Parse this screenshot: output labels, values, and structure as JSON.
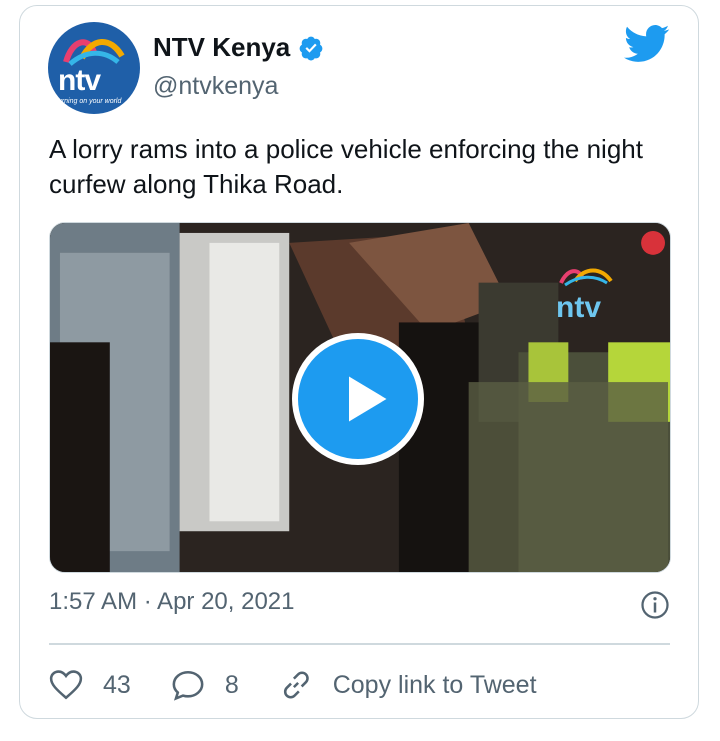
{
  "author": {
    "display_name": "NTV Kenya",
    "handle": "@ntvkenya",
    "avatar_logo_text": "ntv",
    "avatar_tagline": "turning on your world",
    "verified": true
  },
  "tweet": {
    "text": "A lorry rams into a police vehicle enforcing the night curfew along Thika Road.",
    "timestamp": "1:57 AM · Apr 20, 2021"
  },
  "media": {
    "watermark": "ntv",
    "type": "video"
  },
  "actions": {
    "likes": "43",
    "replies": "8",
    "copy_link": "Copy link to Tweet"
  },
  "colors": {
    "accent": "#1d9bf0",
    "secondary_text": "#536471",
    "border": "#cfd9de"
  },
  "icons": [
    "verified-badge-icon",
    "twitter-bird-icon",
    "play-icon",
    "info-icon",
    "heart-icon",
    "reply-icon",
    "link-icon"
  ]
}
